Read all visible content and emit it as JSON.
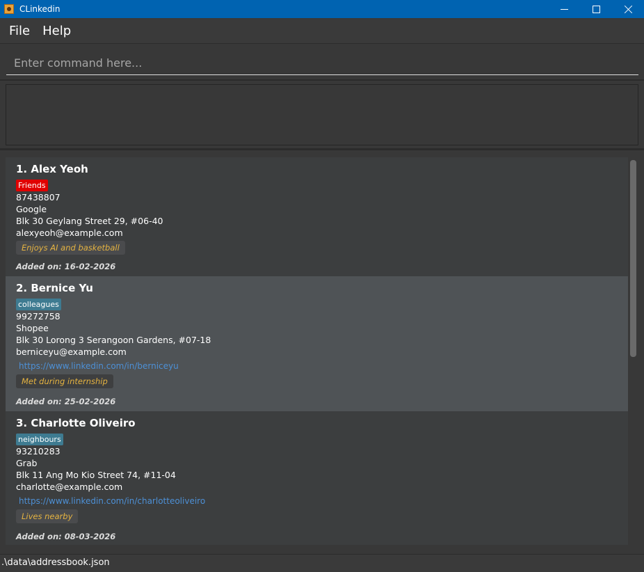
{
  "window": {
    "title": "CLinkedin"
  },
  "menu": {
    "file": "File",
    "help": "Help"
  },
  "command": {
    "placeholder": "Enter command here..."
  },
  "persons": [
    {
      "name": "1. Alex Yeoh",
      "tag": "Friends",
      "tag_color": "#e00000",
      "phone": "87438807",
      "company": "Google",
      "address": "Blk 30 Geylang Street 29, #06-40",
      "email": "alexyeoh@example.com",
      "linkedin": "",
      "note": "Enjoys AI and basketball",
      "added": "Added on: 16-02-2026"
    },
    {
      "name": "2. Bernice Yu",
      "tag": "colleagues",
      "tag_color": "#3e7b91",
      "phone": "99272758",
      "company": "Shopee",
      "address": "Blk 30 Lorong 3 Serangoon Gardens, #07-18",
      "email": "berniceyu@example.com",
      "linkedin": "https://www.linkedin.com/in/berniceyu",
      "note": "Met during internship",
      "added": "Added on: 25-02-2026"
    },
    {
      "name": "3. Charlotte Oliveiro",
      "tag": "neighbours",
      "tag_color": "#3e7b91",
      "phone": "93210283",
      "company": "Grab",
      "address": "Blk 11 Ang Mo Kio Street 74, #11-04",
      "email": "charlotte@example.com",
      "linkedin": "https://www.linkedin.com/in/charlotteoliveiro",
      "note": "Lives nearby",
      "added": "Added on: 08-03-2026"
    }
  ],
  "status": {
    "file_path": ".\\data\\addressbook.json"
  }
}
